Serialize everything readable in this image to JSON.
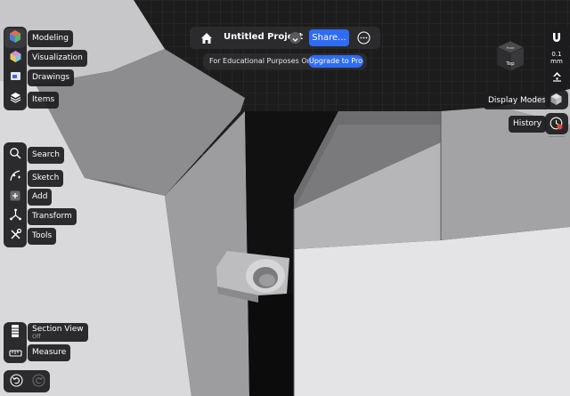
{
  "header": {
    "project_title": "Untitled Project",
    "share_label": "Share...",
    "edu_notice": "For Educational Purposes Only",
    "upgrade_label": "Upgrade to Pro"
  },
  "left_toolbar": {
    "workspace": [
      "Modeling",
      "Visualization",
      "Drawings",
      "Items"
    ],
    "tools": [
      "Search",
      "Sketch",
      "Add",
      "Transform",
      "Tools"
    ],
    "bottom": {
      "section_view": "Section View",
      "section_view_state": "Off",
      "measure": "Measure"
    }
  },
  "right_toolbar": {
    "grid_value": "0.1",
    "grid_unit": "mm",
    "display_modes": "Display Modes",
    "history": "History"
  },
  "view_cube": {
    "top_face": "Top",
    "front_face": "Front"
  },
  "colors": {
    "accent": "#2f6cf4",
    "toolbar_bg": "#1c1c1e",
    "history_badge": "#e5483a"
  }
}
